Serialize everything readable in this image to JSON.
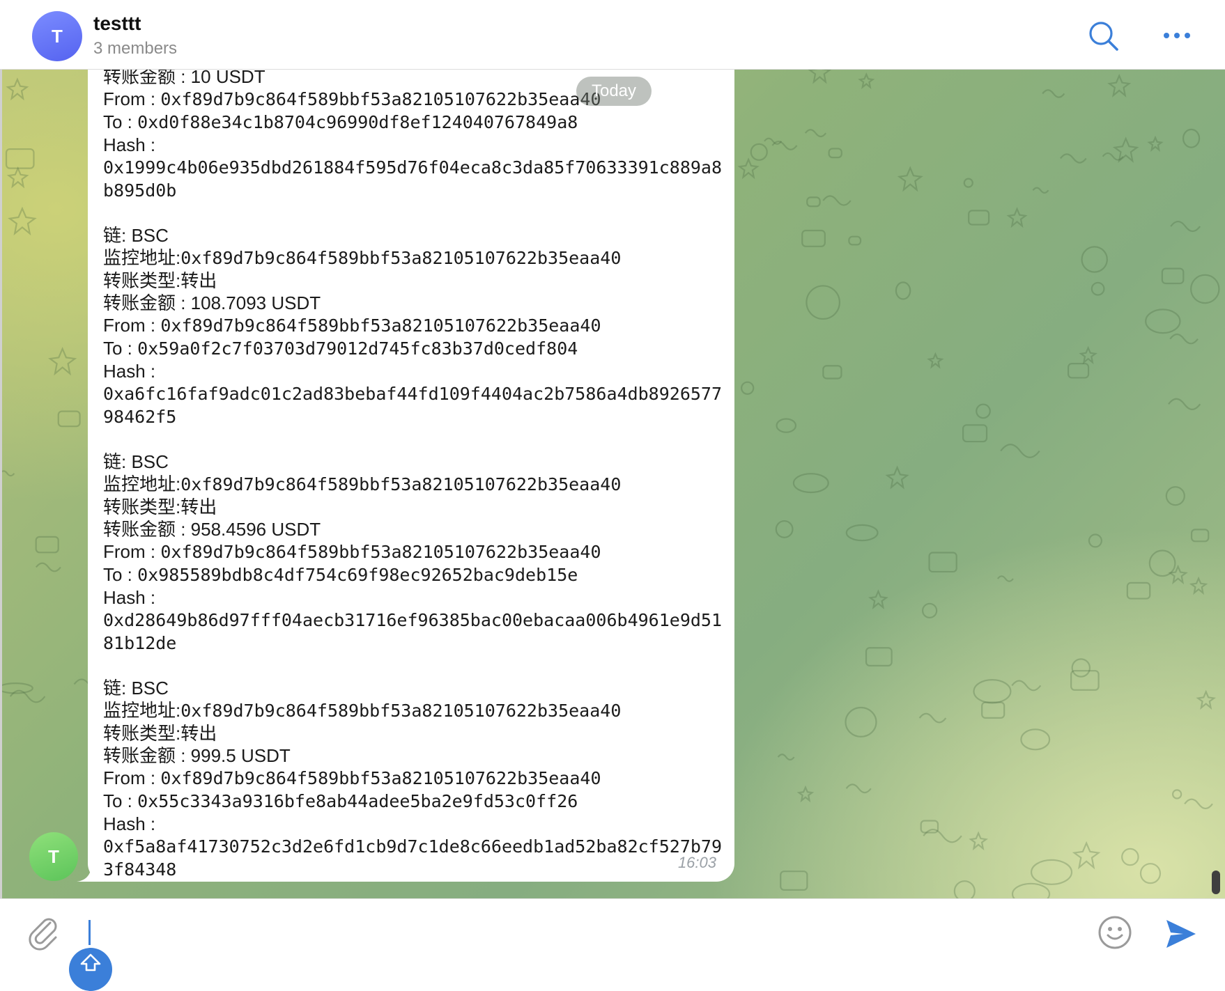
{
  "header": {
    "avatar_letter": "T",
    "title": "testtt",
    "subtitle": "3 members"
  },
  "chat": {
    "date_separator": "Today",
    "sender_avatar_letter": "T",
    "message": {
      "time": "16:03",
      "blocks": [
        {
          "lines": [
            {
              "t": "转账金额 : 10 USDT",
              "mono": false
            },
            {
              "l": "From : ",
              "v": "0xf89d7b9c864f589bbf53a82105107622b35eaa40"
            },
            {
              "l": "To : ",
              "v": "0xd0f88e34c1b8704c96990df8ef124040767849a8"
            },
            {
              "t": "Hash :",
              "mono": false
            },
            {
              "v": "0x1999c4b06e935dbd261884f595d76f04eca8c3da85f70633391c889a8b895d0b"
            }
          ]
        },
        {
          "lines": [
            {
              "t": "链: BSC",
              "mono": false
            },
            {
              "l": "监控地址:",
              "v": "0xf89d7b9c864f589bbf53a82105107622b35eaa40"
            },
            {
              "t": "转账类型:转出",
              "mono": false
            },
            {
              "t": "转账金额 : 108.7093 USDT",
              "mono": false
            },
            {
              "l": "From : ",
              "v": "0xf89d7b9c864f589bbf53a82105107622b35eaa40"
            },
            {
              "l": "To : ",
              "v": "0x59a0f2c7f03703d79012d745fc83b37d0cedf804"
            },
            {
              "t": "Hash :",
              "mono": false
            },
            {
              "v": "0xa6fc16faf9adc01c2ad83bebaf44fd109f4404ac2b7586a4db892657798462f5"
            }
          ]
        },
        {
          "lines": [
            {
              "t": "链: BSC",
              "mono": false
            },
            {
              "l": "监控地址:",
              "v": "0xf89d7b9c864f589bbf53a82105107622b35eaa40"
            },
            {
              "t": "转账类型:转出",
              "mono": false
            },
            {
              "t": "转账金额 : 958.4596 USDT",
              "mono": false
            },
            {
              "l": "From : ",
              "v": "0xf89d7b9c864f589bbf53a82105107622b35eaa40"
            },
            {
              "l": "To : ",
              "v": "0x985589bdb8c4df754c69f98ec92652bac9deb15e"
            },
            {
              "t": "Hash :",
              "mono": false
            },
            {
              "v": "0xd28649b86d97fff04aecb31716ef96385bac00ebacaa006b4961e9d5181b12de"
            }
          ]
        },
        {
          "lines": [
            {
              "t": "链: BSC",
              "mono": false
            },
            {
              "l": "监控地址:",
              "v": "0xf89d7b9c864f589bbf53a82105107622b35eaa40"
            },
            {
              "t": "转账类型:转出",
              "mono": false
            },
            {
              "t": "转账金额 : 999.5 USDT",
              "mono": false
            },
            {
              "l": "From : ",
              "v": "0xf89d7b9c864f589bbf53a82105107622b35eaa40"
            },
            {
              "l": "To : ",
              "v": "0x55c3343a9316bfe8ab44adee5ba2e9fd53c0ff26"
            },
            {
              "t": "Hash :",
              "mono": false
            },
            {
              "v": "0xf5a8af41730752c3d2e6fd1cb9d7c1de8c66eedb1ad52ba82cf527b793f84348"
            }
          ]
        }
      ]
    }
  },
  "composer": {
    "input_value": "",
    "input_placeholder": ""
  },
  "icons": {
    "search": "search-icon",
    "more": "more-dots-icon",
    "attach": "paperclip-icon",
    "emoji": "smiley-icon",
    "send": "send-icon",
    "shift": "shift-arrow-icon"
  },
  "colors": {
    "accent": "#3b7fd9",
    "group_avatar": "#6673f5",
    "sender_avatar": "#6fcf63"
  }
}
